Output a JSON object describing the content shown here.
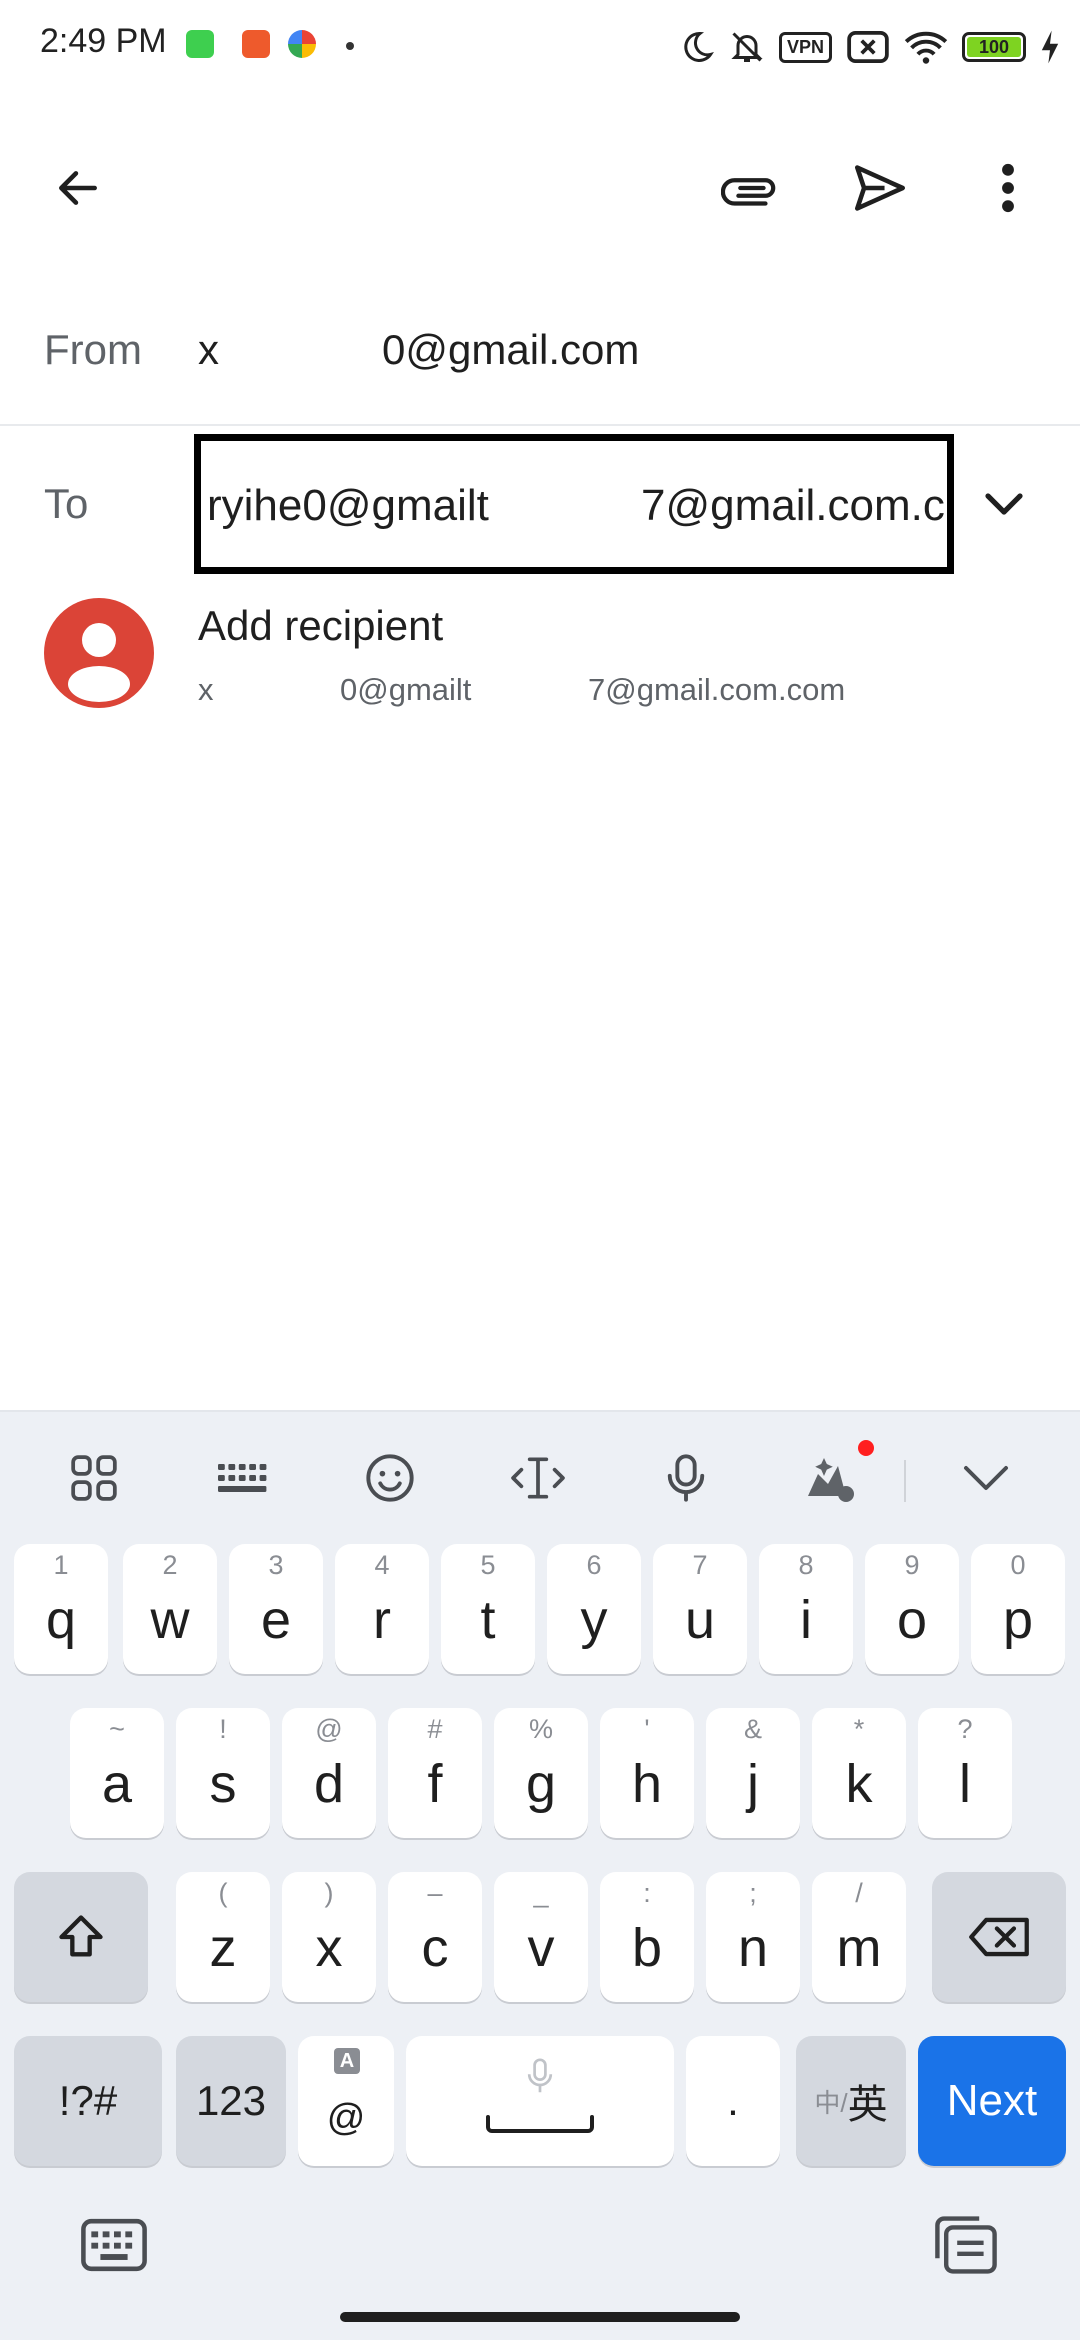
{
  "status_bar": {
    "time": "2:49 PM",
    "vpn_label": "VPN",
    "battery_level": "100"
  },
  "compose": {
    "from_label": "From",
    "from_name": "x",
    "from_email": "0@gmail.com",
    "to_label": "To",
    "to_value_part1": "ryihe0@gmailt",
    "to_value_part2": "7@gmail.com.c",
    "suggestion_title": "Add recipient",
    "suggestion_sub1": "x",
    "suggestion_sub2": "0@gmailt",
    "suggestion_sub3": "7@gmail.com.com"
  },
  "keyboard": {
    "row1": [
      {
        "hint": "1",
        "key": "q"
      },
      {
        "hint": "2",
        "key": "w"
      },
      {
        "hint": "3",
        "key": "e"
      },
      {
        "hint": "4",
        "key": "r"
      },
      {
        "hint": "5",
        "key": "t"
      },
      {
        "hint": "6",
        "key": "y"
      },
      {
        "hint": "7",
        "key": "u"
      },
      {
        "hint": "8",
        "key": "i"
      },
      {
        "hint": "9",
        "key": "o"
      },
      {
        "hint": "0",
        "key": "p"
      }
    ],
    "row2": [
      {
        "hint": "~",
        "key": "a"
      },
      {
        "hint": "!",
        "key": "s"
      },
      {
        "hint": "@",
        "key": "d"
      },
      {
        "hint": "#",
        "key": "f"
      },
      {
        "hint": "%",
        "key": "g"
      },
      {
        "hint": "'",
        "key": "h"
      },
      {
        "hint": "&",
        "key": "j"
      },
      {
        "hint": "*",
        "key": "k"
      },
      {
        "hint": "?",
        "key": "l"
      }
    ],
    "row3": [
      {
        "hint": "(",
        "key": "z"
      },
      {
        "hint": ")",
        "key": "x"
      },
      {
        "hint": "–",
        "key": "c"
      },
      {
        "hint": "_",
        "key": "v"
      },
      {
        "hint": ":",
        "key": "b"
      },
      {
        "hint": ";",
        "key": "n"
      },
      {
        "hint": "/",
        "key": "m"
      }
    ],
    "symbols_label": "!?#",
    "numbers_label": "123",
    "at_hint": "A",
    "at_label": "@",
    "period_label": ".",
    "lang_label_zh": "中/",
    "lang_label_en": "英",
    "next_label": "Next"
  },
  "colors": {
    "accent": "#1a73e8",
    "avatar": "#db4437",
    "keyboard_bg": "#edf0f5"
  }
}
